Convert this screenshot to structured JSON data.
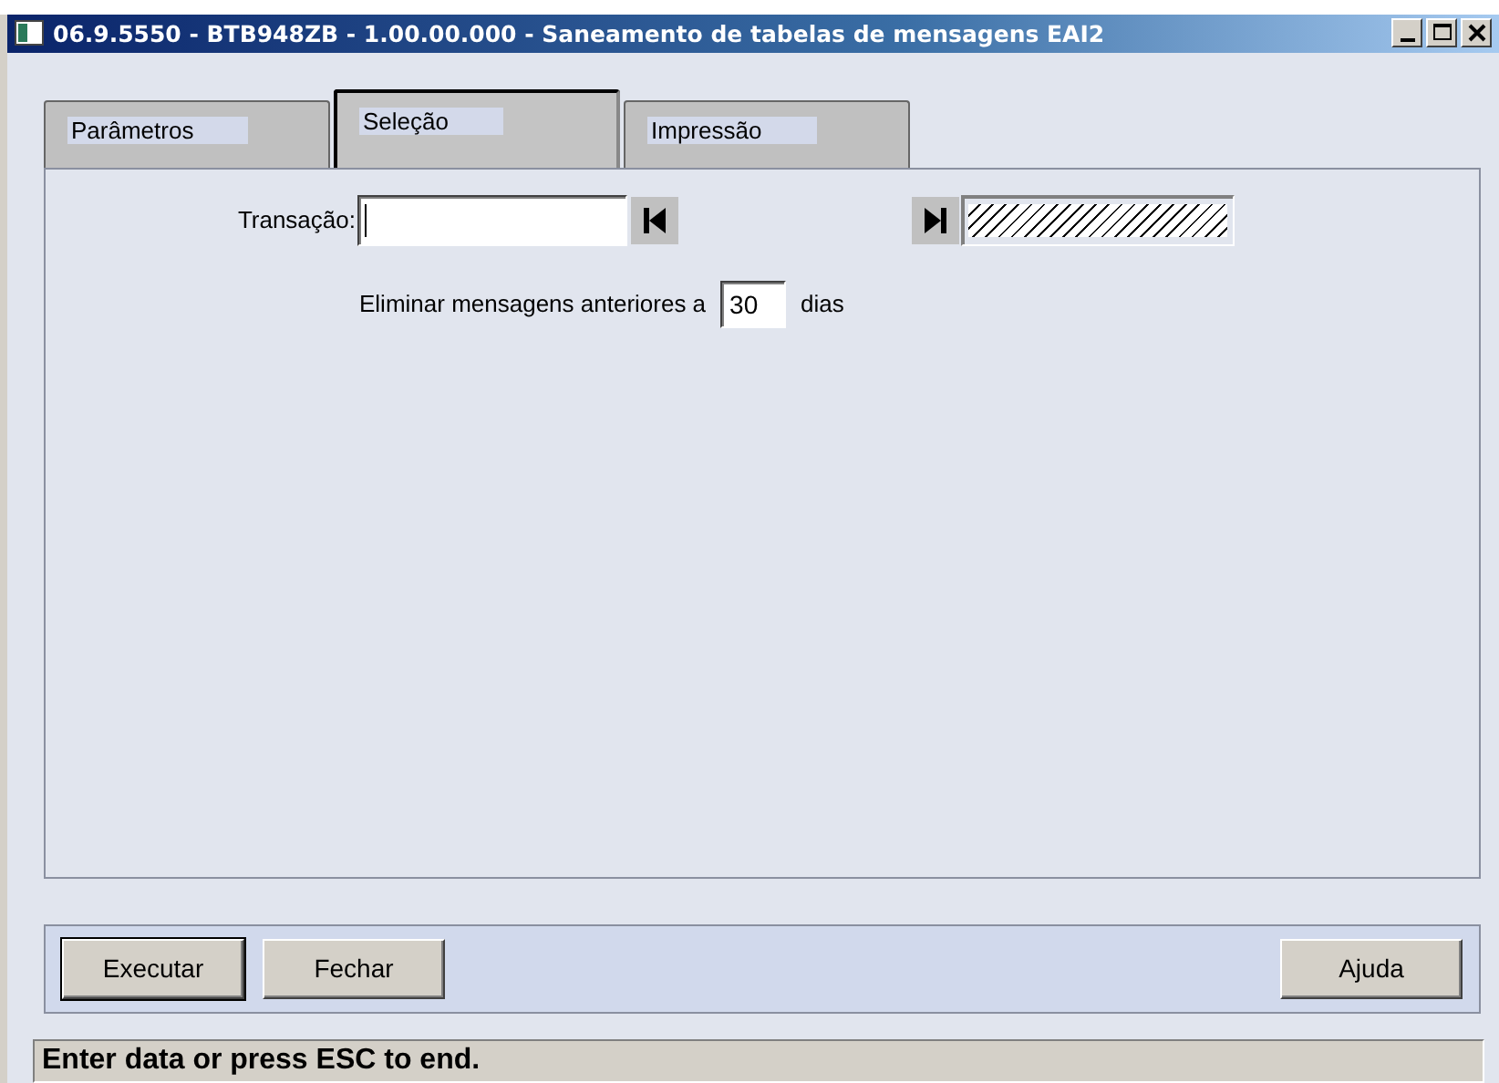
{
  "window": {
    "title": "06.9.5550 - BTB948ZB - 1.00.00.000 - Saneamento de tabelas de mensagens EAI2"
  },
  "tabs": [
    {
      "label": "Parâmetros",
      "selected": false
    },
    {
      "label": "Seleção",
      "selected": true
    },
    {
      "label": "Impressão",
      "selected": false
    }
  ],
  "transacao": {
    "label": "Transação:",
    "to_disabled": true
  },
  "eliminar": {
    "label": "Eliminar mensagens anteriores a",
    "value": "30",
    "unit": "dias"
  },
  "buttons": [
    {
      "label": "Executar",
      "default": true,
      "kind": "left"
    },
    {
      "label": "Fechar",
      "default": false,
      "kind": "left"
    },
    {
      "label": "Ajuda",
      "default": false,
      "kind": "right"
    }
  ],
  "status_bar": "Enter data or press ESC to end."
}
